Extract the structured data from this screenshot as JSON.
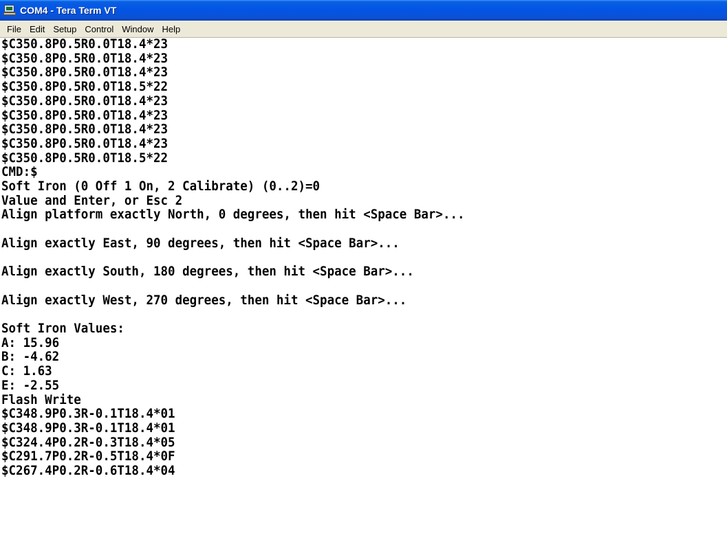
{
  "window": {
    "title": "COM4 - Tera Term VT",
    "icon": "tera-term-icon"
  },
  "menu": [
    "File",
    "Edit",
    "Setup",
    "Control",
    "Window",
    "Help"
  ],
  "terminal": {
    "lines": [
      "$C350.8P0.5R0.0T18.4*23",
      "$C350.8P0.5R0.0T18.4*23",
      "$C350.8P0.5R0.0T18.4*23",
      "$C350.8P0.5R0.0T18.5*22",
      "$C350.8P0.5R0.0T18.4*23",
      "$C350.8P0.5R0.0T18.4*23",
      "$C350.8P0.5R0.0T18.4*23",
      "$C350.8P0.5R0.0T18.4*23",
      "$C350.8P0.5R0.0T18.5*22",
      "CMD:$",
      "Soft Iron (0 Off 1 On, 2 Calibrate) (0..2)=0",
      "Value and Enter, or Esc 2",
      "Align platform exactly North, 0 degrees, then hit <Space Bar>...",
      "",
      "Align exactly East, 90 degrees, then hit <Space Bar>...",
      "",
      "Align exactly South, 180 degrees, then hit <Space Bar>...",
      "",
      "Align exactly West, 270 degrees, then hit <Space Bar>...",
      "",
      "Soft Iron Values:",
      "A: 15.96",
      "B: -4.62",
      "C: 1.63",
      "E: -2.55",
      "Flash Write",
      "$C348.9P0.3R-0.1T18.4*01",
      "$C348.9P0.3R-0.1T18.4*01",
      "$C324.4P0.2R-0.3T18.4*05",
      "$C291.7P0.2R-0.5T18.4*0F",
      "$C267.4P0.2R-0.6T18.4*04"
    ]
  },
  "colors": {
    "titlebar": "#0355e6",
    "menubar": "#ece9d8",
    "terminal_bg": "#ffffff",
    "terminal_fg": "#000000"
  }
}
